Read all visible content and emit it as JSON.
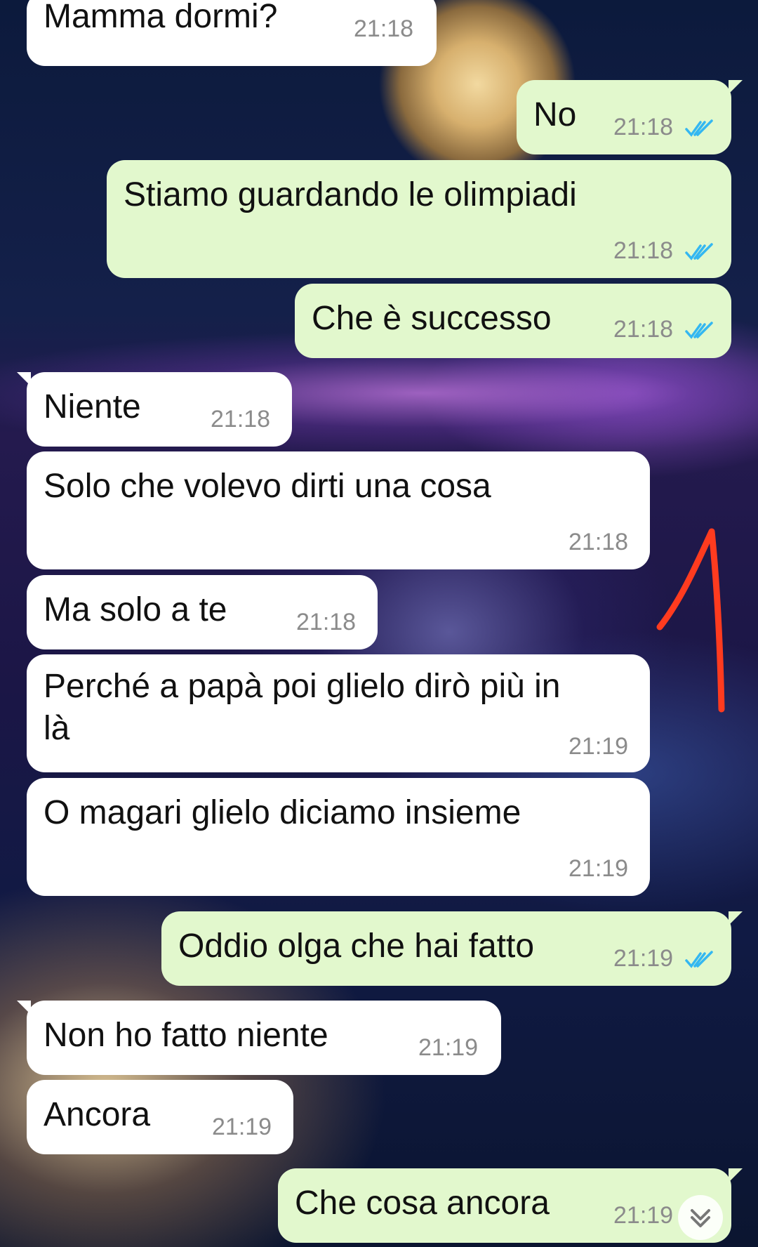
{
  "colors": {
    "incoming_bubble": "#ffffff",
    "outgoing_bubble": "#e2f8cd",
    "read_ticks": "#34b7f1",
    "annotation": "#ff3b1f"
  },
  "messages": [
    {
      "text": "Mamma dormi?",
      "time": "21:18",
      "direction": "incoming"
    },
    {
      "text": "No",
      "time": "21:18",
      "direction": "outgoing",
      "status_icon": "double-check-read-icon"
    },
    {
      "text": "Stiamo guardando le olimpiadi",
      "time": "21:18",
      "direction": "outgoing",
      "status_icon": "double-check-read-icon"
    },
    {
      "text": "Che è successo",
      "time": "21:18",
      "direction": "outgoing",
      "status_icon": "double-check-read-icon"
    },
    {
      "text": "Niente",
      "time": "21:18",
      "direction": "incoming"
    },
    {
      "text": "Solo che volevo dirti una cosa",
      "time": "21:18",
      "direction": "incoming"
    },
    {
      "text": "Ma solo a te",
      "time": "21:18",
      "direction": "incoming"
    },
    {
      "text": "Perché a papà poi glielo dirò più in là",
      "time": "21:19",
      "direction": "incoming"
    },
    {
      "text": "O magari glielo diciamo insieme",
      "time": "21:19",
      "direction": "incoming"
    },
    {
      "text": "Oddio olga che hai fatto",
      "time": "21:19",
      "direction": "outgoing",
      "status_icon": "double-check-read-icon"
    },
    {
      "text": "Non ho fatto niente",
      "time": "21:19",
      "direction": "incoming"
    },
    {
      "text": "Ancora",
      "time": "21:19",
      "direction": "incoming"
    },
    {
      "text": "Che cosa ancora",
      "time": "21:19",
      "direction": "outgoing"
    }
  ],
  "scroll_button_icon": "double-chevron-down-icon",
  "annotation_icon": "red-hand-drawn-number-one"
}
